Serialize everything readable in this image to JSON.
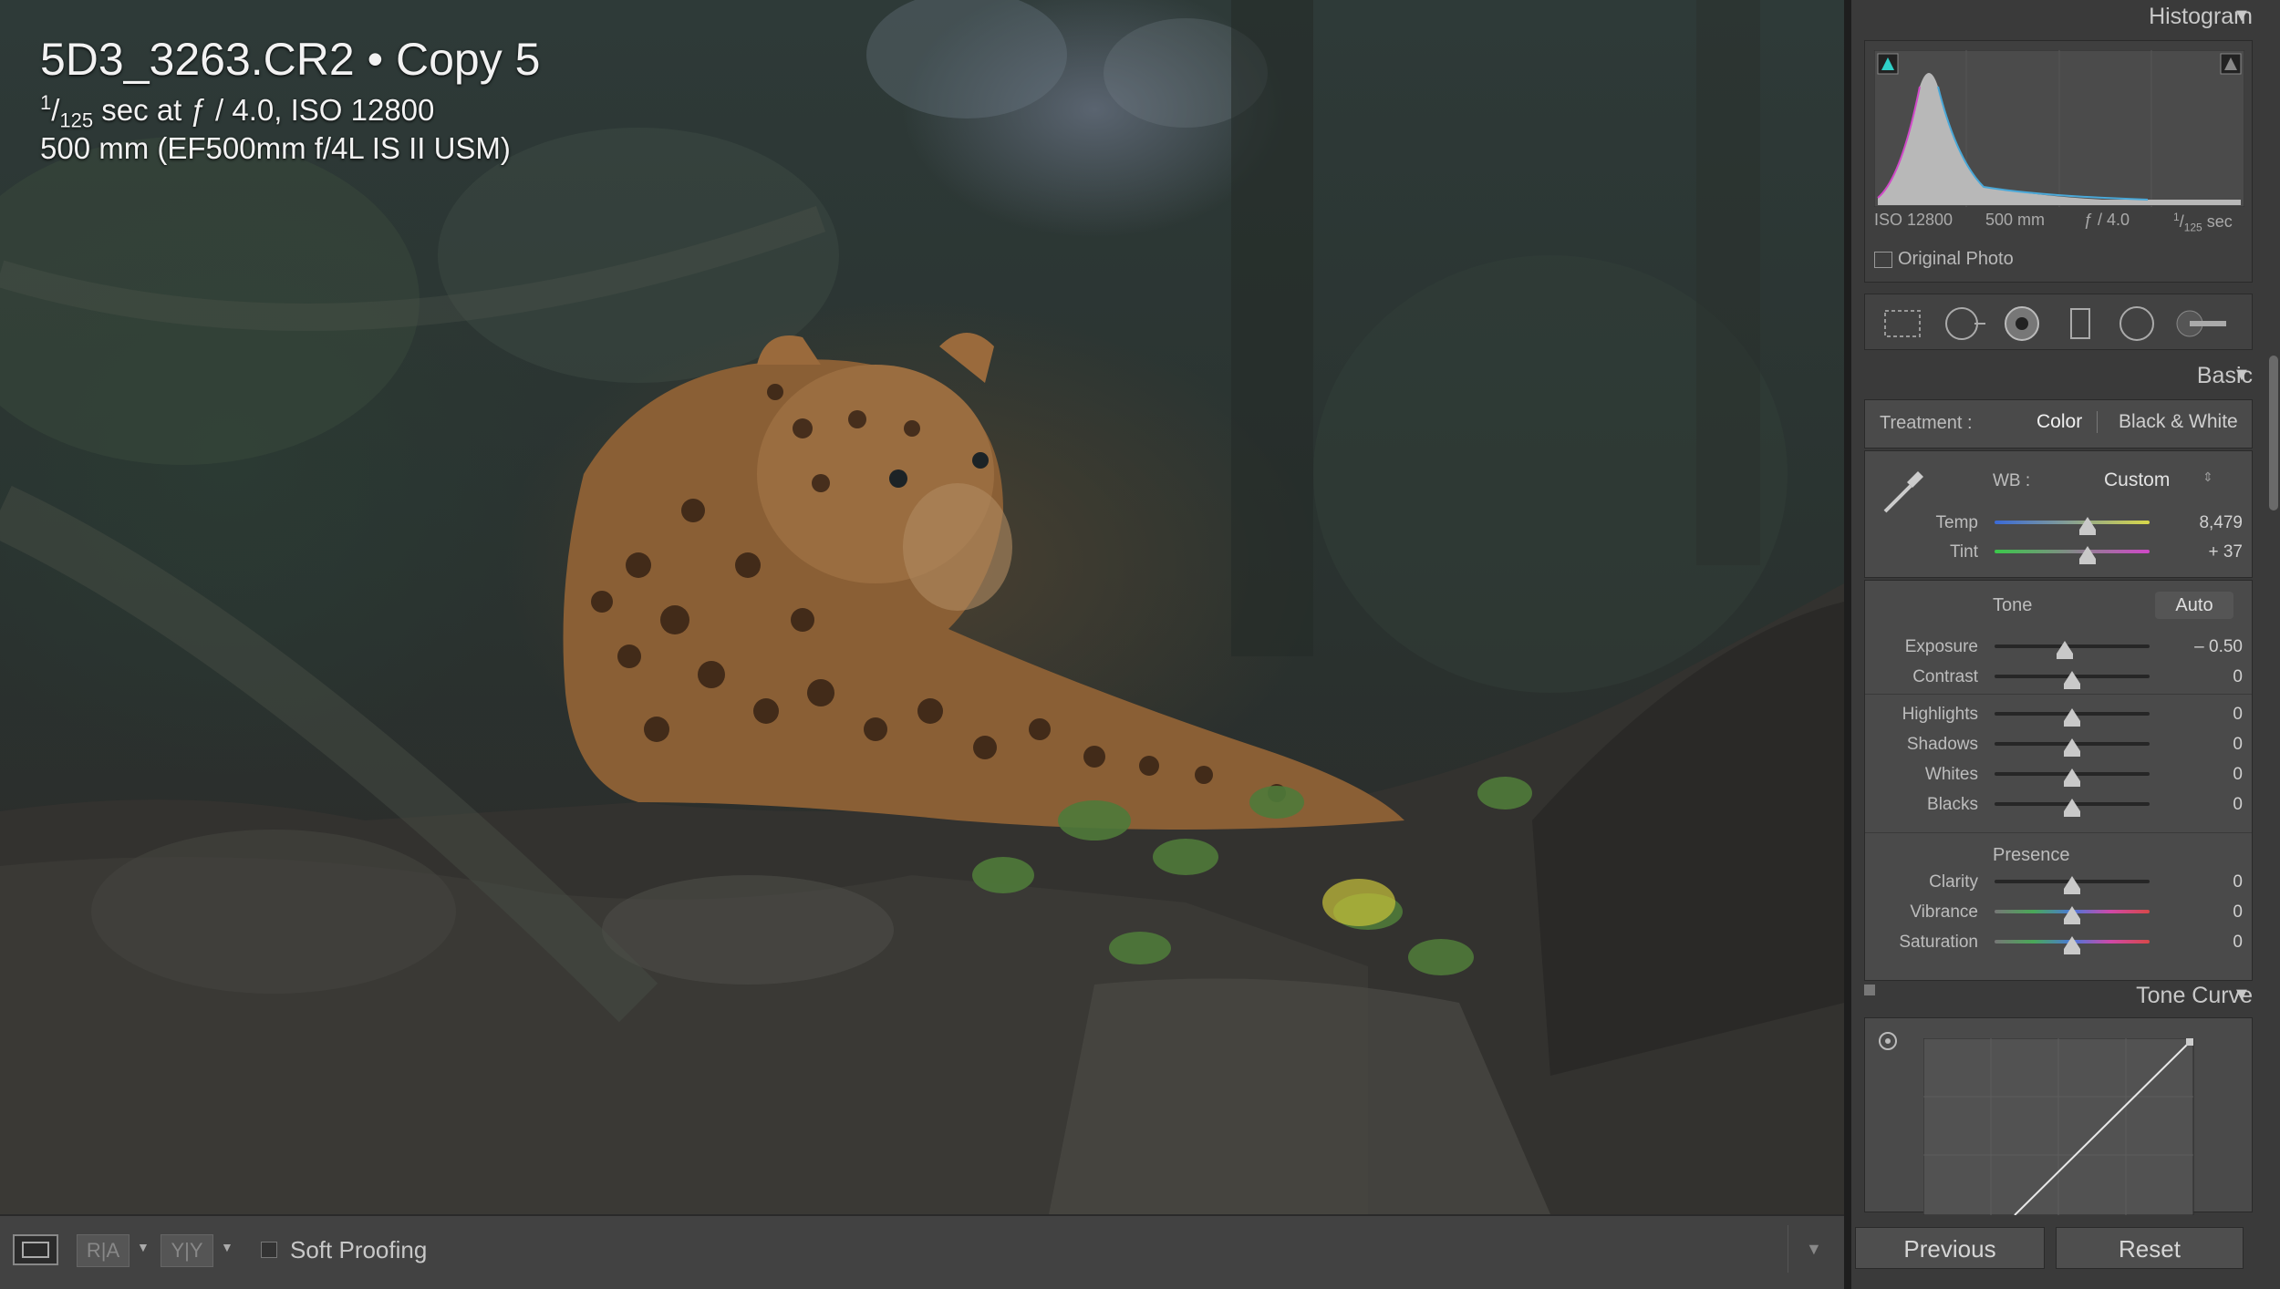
{
  "photo": {
    "title": "5D3_3263.CR2  •  Copy 5",
    "shutter_numerator": "1",
    "shutter_denominator": "125",
    "exposure_rest": " sec at ƒ / 4.0, ISO 12800",
    "lens_line": "500 mm (EF500mm f/4L IS II USM)"
  },
  "histogram": {
    "header": "Histogram",
    "iso": "ISO 12800",
    "focal": "500 mm",
    "aperture": "ƒ / 4.0",
    "shutter_num": "1",
    "shutter_den": "125",
    "shutter_unit": " sec",
    "original_photo_label": "Original Photo"
  },
  "tools": [
    "crop-overlay-icon",
    "spot-removal-icon",
    "red-eye-icon",
    "graduated-filter-icon",
    "radial-filter-icon",
    "adjustment-brush-icon"
  ],
  "basic": {
    "header": "Basic",
    "treatment_label": "Treatment :",
    "color": "Color",
    "bw": "Black & White",
    "wb_label": "WB :",
    "wb_value": "Custom",
    "temp_label": "Temp",
    "temp_value": "8,479",
    "temp_level": 0.6,
    "tint_label": "Tint",
    "tint_value": "+ 37",
    "tint_level": 0.6,
    "tone_label": "Tone",
    "auto": "Auto",
    "tone_sliders": [
      {
        "label": "Exposure",
        "value": "– 0.50",
        "level": 0.45
      },
      {
        "label": "Contrast",
        "value": "0",
        "level": 0.5
      }
    ],
    "tone_sliders2": [
      {
        "label": "Highlights",
        "value": "0",
        "level": 0.5
      },
      {
        "label": "Shadows",
        "value": "0",
        "level": 0.5
      },
      {
        "label": "Whites",
        "value": "0",
        "level": 0.5
      },
      {
        "label": "Blacks",
        "value": "0",
        "level": 0.5
      }
    ],
    "presence_label": "Presence",
    "presence_sliders": [
      {
        "label": "Clarity",
        "value": "0",
        "level": 0.5
      },
      {
        "label": "Vibrance",
        "value": "0",
        "level": 0.5
      },
      {
        "label": "Saturation",
        "value": "0",
        "level": 0.5
      }
    ]
  },
  "tone_curve": {
    "header": "Tone Curve"
  },
  "toolbar": {
    "soft_proofing": "Soft Proofing",
    "ra": "R|A",
    "yy": "Y|Y"
  },
  "buttons": {
    "previous": "Previous",
    "reset": "Reset"
  },
  "colors": {
    "panel": "#3a3a3a",
    "box": "#4a4a4a",
    "toolbar": "#424242"
  }
}
